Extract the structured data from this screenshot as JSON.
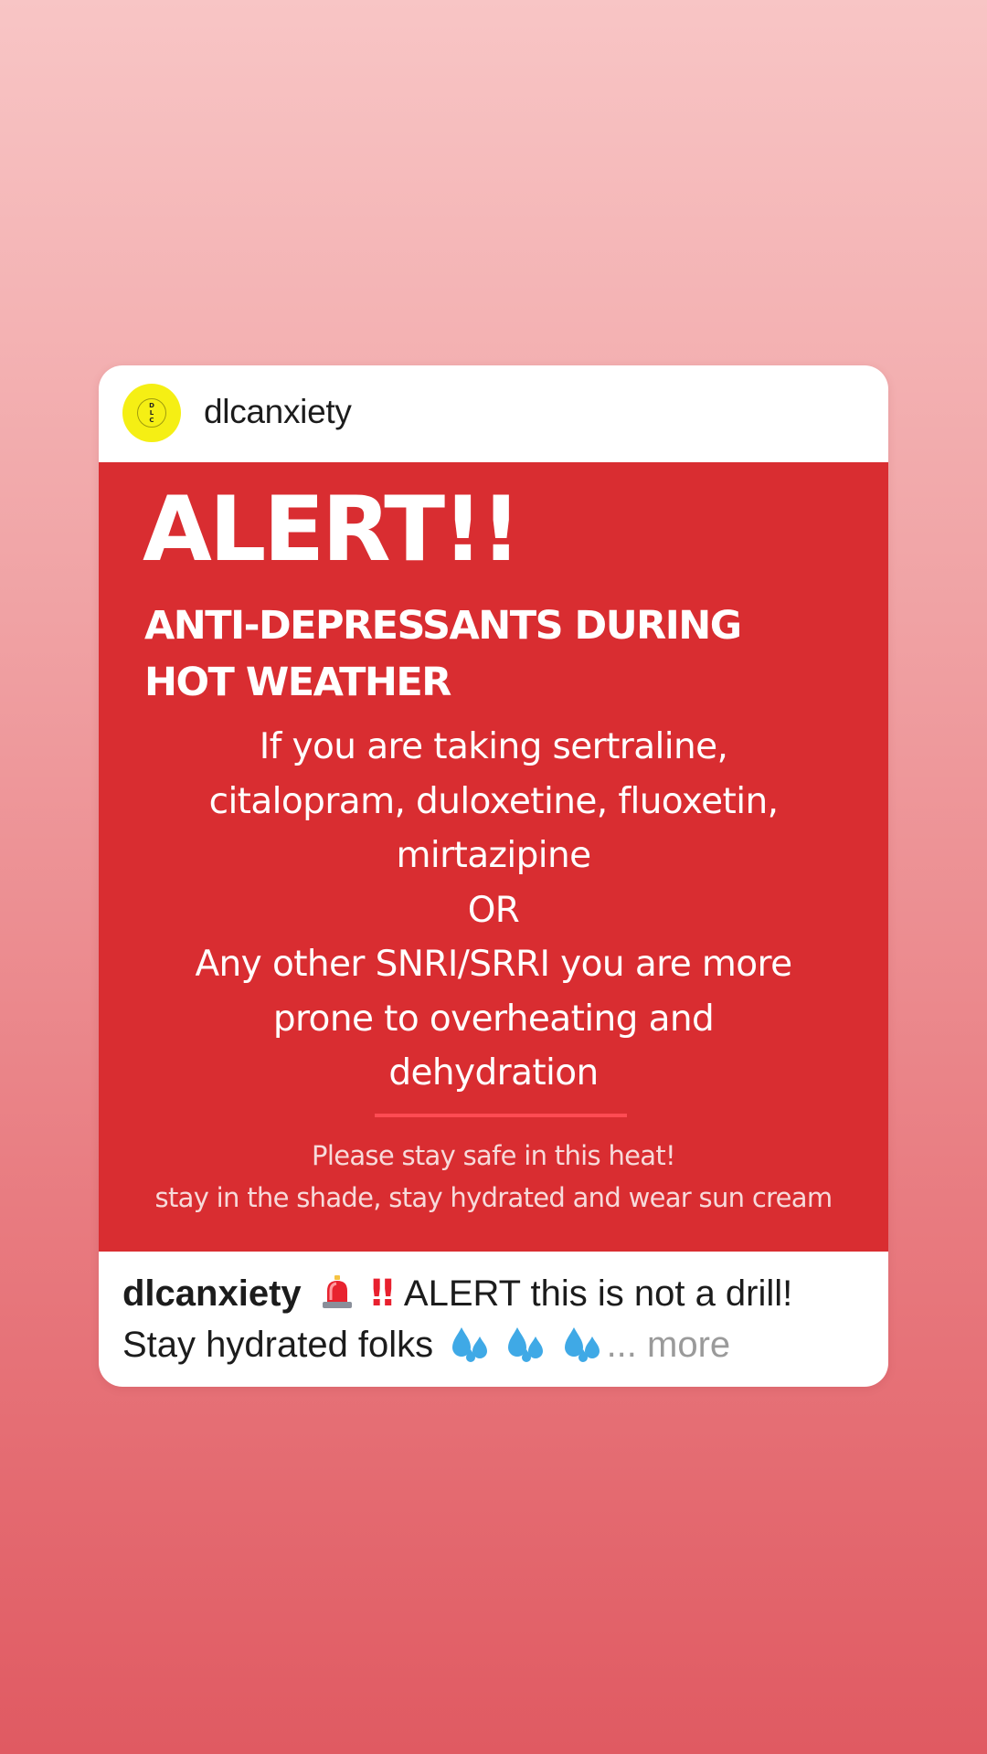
{
  "post": {
    "username": "dlcanxiety",
    "avatar_letters": [
      "D",
      "L",
      "C"
    ],
    "image": {
      "headline": "ALERT!!",
      "subtitle_lines": [
        "ANTI-DEPRESSANTS DURING",
        "HOT WEATHER"
      ],
      "body_lines": [
        "If you are taking sertraline,",
        "citalopram, duloxetine, fluoxetin,",
        "mirtazipine",
        "OR",
        "Any other SNRI/SRRI you are more",
        "prone to overheating and",
        "dehydration"
      ],
      "footer_lines": [
        "Please stay safe in this heat!",
        "stay in the shade, stay hydrated and wear sun cream"
      ]
    },
    "caption": {
      "username": "dlcanxiety",
      "emoji_siren": "siren-icon",
      "emoji_bang": "‼",
      "text_line1": "ALERT this is not a drill!",
      "text_line2": "Stay hydrated folks",
      "emoji_drops": "sweat-droplets-icon",
      "ellipsis": "...",
      "more_label": "more"
    }
  },
  "colors": {
    "background_top": "#f8c5c5",
    "background_bottom": "#e05a62",
    "post_red": "#d92d31",
    "avatar_yellow": "#f5ef14",
    "divider": "#ff4b53"
  }
}
